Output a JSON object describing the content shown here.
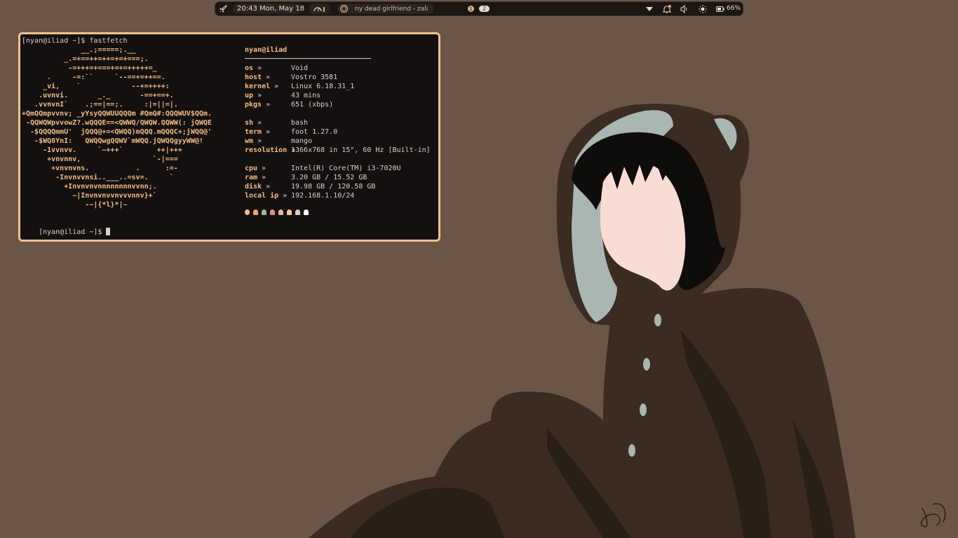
{
  "topbar": {
    "clock": "20:43 Mon, May 18",
    "media_title": "ny dead girlfriend - zalaku",
    "workspace_active": "1",
    "workspace_count": "2",
    "battery": "66%"
  },
  "terminal": {
    "prompt_command": "[nyan@iliad ~]$ fastfetch",
    "prompt_end": "[nyan@iliad ~]$ ",
    "logo_lines": [
      "              __.;=====;.__",
      "          _.=+==++=++=+=+===;.",
      "           -=+++=+===+=+=+++++=_",
      "      .     -=:``     `--==+=++==.",
      "     _vi,    `            --+=++++:",
      "    .uvnvi.       _._       -==+==+.",
      "   .vvnvnI`    .;==|==;.     :|=||=|.",
      "+QmQQmpvvnv; _yYsyQQWUUQQQm #QmQ#:QQQWUV$QQm.",
      " -QQWQWpvvowZ?.wQQQE==<QWWQ/QWQW.QQWW(: jQWQE",
      "  -$QQQQmmU'  jQQQ@+=<QWQQ)mQQQ.mQQQC+;jWQQ@'",
      "   -$WQ8YnI:   QWQQwgQQWV`mWQQ.jQWQQgyyWW@!",
      "     -1vvnvv.     `~+++`        ++|+++",
      "      +vnvnnv,                 `-|===",
      "       +vnvnvns.           .      :=-",
      "        -Invnvvnsi..___..=sv=.     `",
      "          +Invnvnvnnnnnnnnvvnn;.",
      "            ~|Invnvnvvnvvvnnv}+`",
      "               -~|{*l}*|~"
    ],
    "user_host": "nyan@iliad",
    "info": [
      {
        "key": "os",
        "value": "Void"
      },
      {
        "key": "host",
        "value": "Vostro 3581"
      },
      {
        "key": "kernel",
        "value": "Linux 6.18.31_1"
      },
      {
        "key": "up",
        "value": "43 mins"
      },
      {
        "key": "pkgs",
        "value": "651 (xbps)"
      },
      {
        "key": "sh",
        "value": "bash"
      },
      {
        "key": "term",
        "value": "foot 1.27.0"
      },
      {
        "key": "wm",
        "value": "mango"
      },
      {
        "key": "resolution",
        "value": "1366x768 in 15\", 60 Hz [Built-in]"
      },
      {
        "key": "cpu",
        "value": "Intel(R) Core(TM) i3-7020U"
      },
      {
        "key": "ram",
        "value": "3.20 GB / 15.52 GB"
      },
      {
        "key": "disk",
        "value": "19.98 GB / 120.58 GB"
      },
      {
        "key": "local ip",
        "value": "192.168.1.10/24"
      }
    ],
    "separator_glyph": "»"
  },
  "colors": {
    "accent": "#f3c08f",
    "terminal_bg": "#151010",
    "desktop_bg": "#6a5547",
    "palette": [
      "#f0bd86",
      "#e8a86a",
      "#9bb890",
      "#d88b8b",
      "#e0b49a",
      "#f0c896",
      "#d8d0c8",
      "#ffffff"
    ]
  },
  "icons": {
    "launcher": "rocket-icon",
    "cpu_meter": "gauge-icon",
    "music": "music-disc-icon",
    "dropdown": "chevron-down-icon",
    "notifications": "bell-icon",
    "volume": "speaker-icon",
    "brightness": "sun-icon",
    "battery": "battery-icon"
  }
}
